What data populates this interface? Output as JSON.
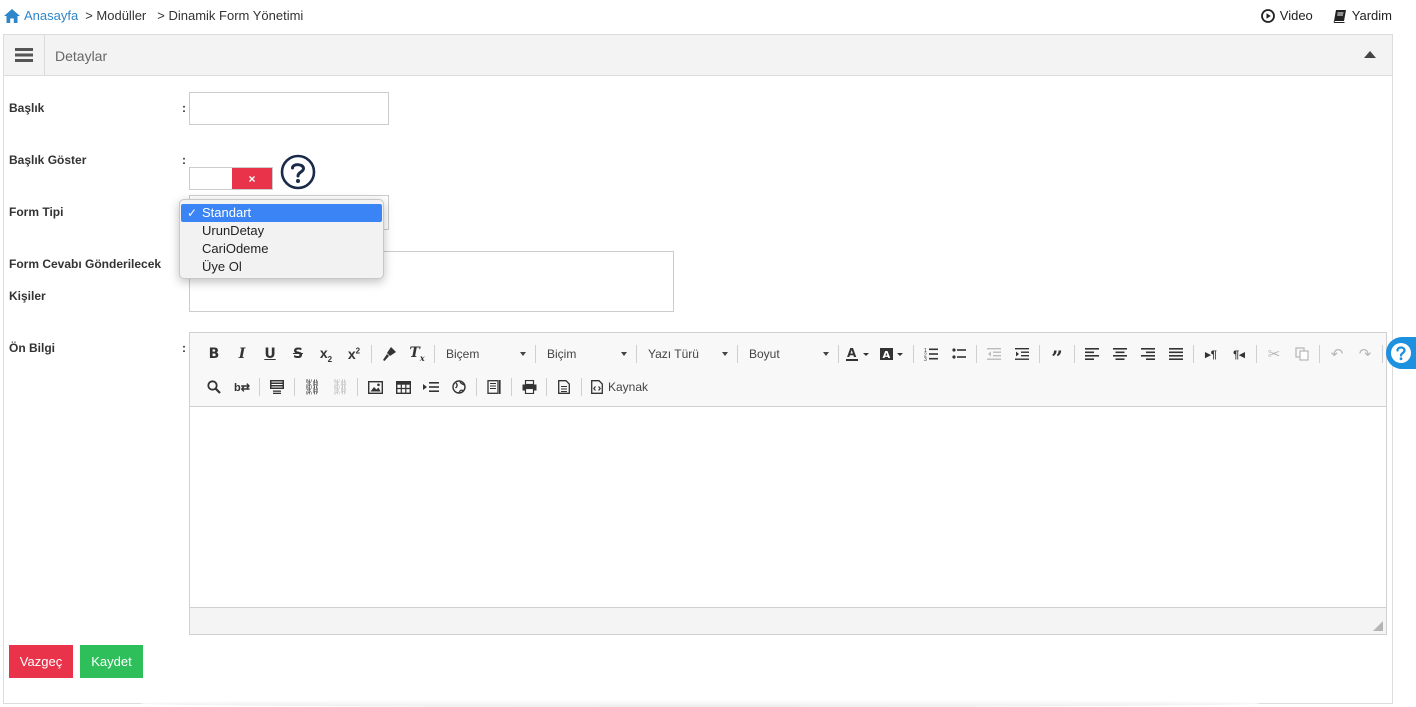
{
  "breadcrumb": {
    "home": "Anasayfa",
    "items": [
      "> Modüller",
      "> Dinamik Form Yönetimi"
    ]
  },
  "top_actions": {
    "video": "Video",
    "help": "Yardim"
  },
  "panel": {
    "title": "Detaylar"
  },
  "form": {
    "title_label": "Başlık",
    "show_title_label": "Başlık Göster",
    "show_title_toggle": "×",
    "form_type_label": "Form Tipi",
    "form_type_options": [
      "Standart",
      "UrunDetay",
      "CariOdeme",
      "Üye Ol"
    ],
    "form_type_selected_mark": "✓",
    "recipients_label_1": "Form Cevabı Gönderilecek",
    "recipients_label_2": "Kişiler",
    "pre_info_label": "Ön Bilgi",
    "colon": ":"
  },
  "editor": {
    "combo_format": "Biçem",
    "combo_style": "Biçim",
    "combo_font": "Yazı Türü",
    "combo_size": "Boyut",
    "source_label": "Kaynak"
  },
  "buttons": {
    "cancel": "Vazgeç",
    "save": "Kaydet"
  },
  "colors": {
    "link": "#2f86c9",
    "cancel": "#e8334a",
    "save": "#2fbf5a",
    "help": "#1e90e0",
    "dropdown_selected": "#3b84f5"
  }
}
